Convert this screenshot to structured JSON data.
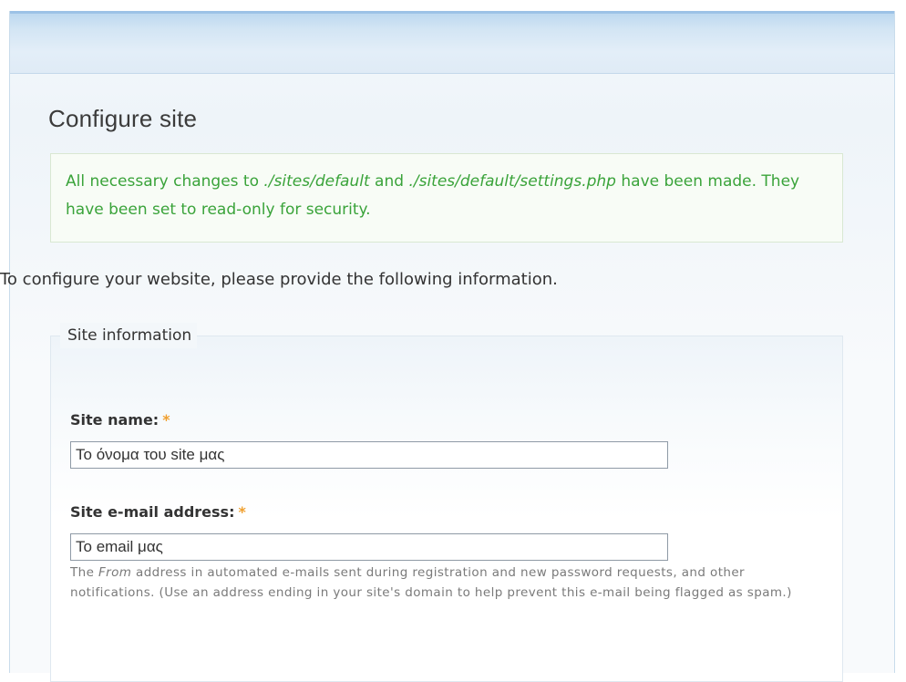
{
  "page": {
    "title": "Configure site",
    "intro": "To configure your website, please provide the following information."
  },
  "status": {
    "part1": "All necessary changes to ",
    "path1": "./sites/default",
    "part2": " and ",
    "path2": "./sites/default/settings.php",
    "part3": " have been made. They have been set to read-only for security.",
    "color": "#3aa33a"
  },
  "site_information": {
    "legend": "Site information",
    "site_name": {
      "label": "Site name:",
      "required_marker": "*",
      "value": "Το όνομα του site μας"
    },
    "site_email": {
      "label": "Site e-mail address:",
      "required_marker": "*",
      "value": "Το email μας",
      "description_part1": "The ",
      "description_from": "From",
      "description_part2": " address in automated e-mails sent during registration and new password requests, and other notifications. (Use an address ending in your site's domain to help prevent this e-mail being flagged as spam.)"
    }
  },
  "colors": {
    "header_blue": "#b9d6ef",
    "required_marker": "#f0a030"
  }
}
